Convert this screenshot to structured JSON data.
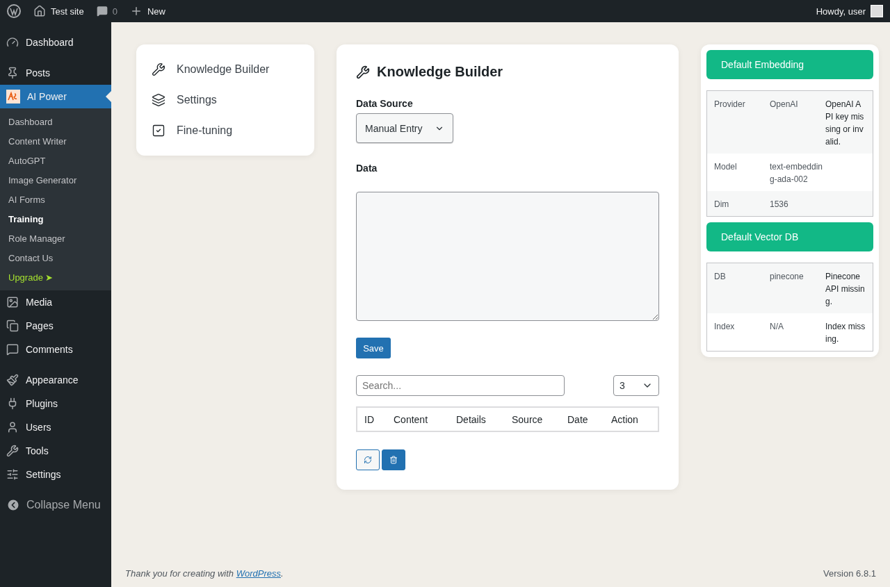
{
  "admin_bar": {
    "site_name": "Test site",
    "comments_count": "0",
    "new_label": "New",
    "greeting": "Howdy, user"
  },
  "sidebar": {
    "groups": [
      {
        "items": [
          {
            "label": "Dashboard",
            "current": false
          }
        ]
      },
      {
        "items": [
          {
            "label": "Posts",
            "current": false
          },
          {
            "label": "AI Power",
            "current": true,
            "submenu": [
              {
                "label": "Dashboard",
                "selected": false,
                "kind": "link"
              },
              {
                "label": "Content Writer",
                "selected": false,
                "kind": "link"
              },
              {
                "label": "AutoGPT",
                "selected": false,
                "kind": "link"
              },
              {
                "label": "Image Generator",
                "selected": false,
                "kind": "link"
              },
              {
                "label": "AI Forms",
                "selected": false,
                "kind": "link"
              },
              {
                "label": "Training",
                "selected": true,
                "kind": "link"
              },
              {
                "label": "Role Manager",
                "selected": false,
                "kind": "link"
              },
              {
                "label": "Contact Us",
                "selected": false,
                "kind": "link"
              },
              {
                "label": "Upgrade",
                "selected": false,
                "kind": "upgrade",
                "arrow": "➤"
              }
            ]
          },
          {
            "label": "Media",
            "current": false
          },
          {
            "label": "Pages",
            "current": false
          },
          {
            "label": "Comments",
            "current": false
          }
        ]
      },
      {
        "items": [
          {
            "label": "Appearance",
            "current": false
          },
          {
            "label": "Plugins",
            "current": false
          },
          {
            "label": "Users",
            "current": false
          },
          {
            "label": "Tools",
            "current": false
          },
          {
            "label": "Settings",
            "current": false
          }
        ]
      }
    ],
    "collapse_label": "Collapse Menu"
  },
  "plugin_nav": [
    {
      "label": "Knowledge Builder"
    },
    {
      "label": "Settings"
    },
    {
      "label": "Fine-tuning"
    }
  ],
  "builder": {
    "title": "Knowledge Builder",
    "data_source_label": "Data Source",
    "data_source_value": "Manual Entry",
    "data_label": "Data",
    "save_label": "Save",
    "search_placeholder": "Search...",
    "page_size": "3",
    "table_columns": [
      "ID",
      "Content",
      "Details",
      "Source",
      "Date",
      "Action"
    ]
  },
  "status_panels": [
    {
      "title": "Default Embedding",
      "rows": [
        [
          "Provider",
          "OpenAI",
          "OpenAI API key missing or invalid."
        ],
        [
          "Model",
          "text-embedding-ada-002",
          ""
        ],
        [
          "Dim",
          "1536",
          ""
        ]
      ]
    },
    {
      "title": "Default Vector DB",
      "rows": [
        [
          "DB",
          "pinecone",
          "Pinecone API missing."
        ],
        [
          "Index",
          "N/A",
          "Index missing."
        ]
      ]
    }
  ],
  "footer": {
    "thanks": "*Thank you for creating with* ",
    "link": "WordPress",
    "after": ".",
    "version": "Version 6.8.1"
  }
}
